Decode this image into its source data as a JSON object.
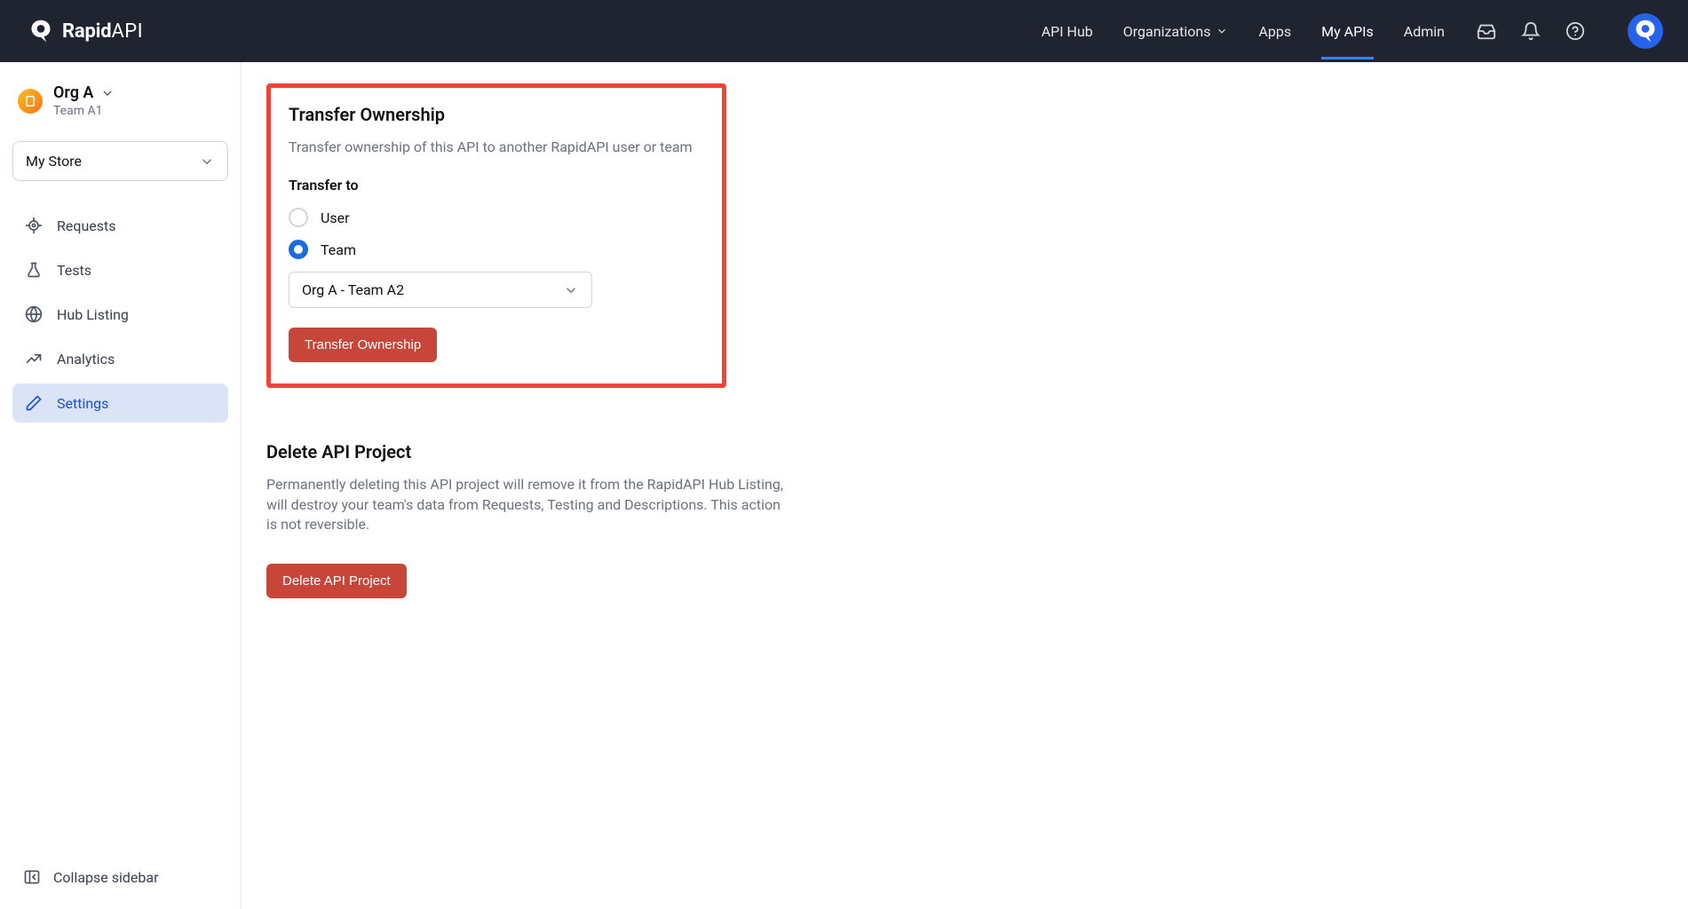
{
  "header": {
    "logo_primary": "Rapid",
    "logo_secondary": "API",
    "nav": {
      "api_hub": "API Hub",
      "organizations": "Organizations",
      "apps": "Apps",
      "my_apis": "My APIs",
      "admin": "Admin"
    }
  },
  "sidebar": {
    "org_name": "Org A",
    "team_name": "Team A1",
    "store_select": "My Store",
    "items": {
      "requests": "Requests",
      "tests": "Tests",
      "hub_listing": "Hub Listing",
      "analytics": "Analytics",
      "settings": "Settings"
    },
    "collapse": "Collapse sidebar"
  },
  "transfer": {
    "title": "Transfer Ownership",
    "desc": "Transfer ownership of this API to another RapidAPI user or team",
    "field_label": "Transfer to",
    "option_user": "User",
    "option_team": "Team",
    "selected_team": "Org A - Team A2",
    "button": "Transfer Ownership"
  },
  "delete": {
    "title": "Delete API Project",
    "desc": "Permanently deleting this API project will remove it from the RapidAPI Hub Listing, will destroy your team's data from Requests, Testing and Descriptions. This action is not reversible.",
    "button": "Delete API Project"
  }
}
